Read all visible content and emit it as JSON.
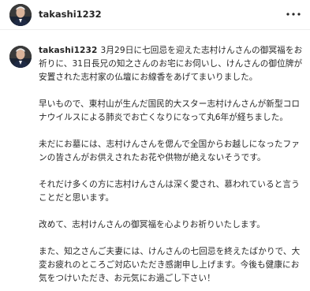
{
  "header": {
    "username": "takashi1232",
    "avatar_icon": "profile-photo-avatar",
    "more_icon": "more-options-icon"
  },
  "post": {
    "username": "takashi1232",
    "paragraphs": [
      "3月29日に七回忌を迎えた志村けんさんの御冥福をお祈りに、31日長兄の知之さんのお宅にお伺いし、けんさんの御位牌が安置された志村家の仏壇にお線香をあげてまいりました。",
      "早いもので、東村山が生んだ国民的大スター志村けんさんが新型コロナウイルスによる肺炎でお亡くなりになって丸6年が経ちました。",
      "未だにお墓には、志村けんさんを偲んで全国からお越しになったファンの皆さんがお供えされたお花や供物が絶えないそうです。",
      "それだけ多くの方に志村けんさんは深く愛され、慕われていると言うことだと思います。",
      "改めて、志村けんさんの御冥福を心よりお祈りいたします。",
      "また、知之さんご夫妻には、けんさんの七回忌を終えたばかりで、大変お疲れのところご対応いただき感謝申し上げます。今後も健康にお気をつけいただき、お元気にお過ごし下さい！"
    ]
  },
  "colors": {
    "text": "#262626",
    "divider": "#efefef",
    "background": "#ffffff"
  }
}
